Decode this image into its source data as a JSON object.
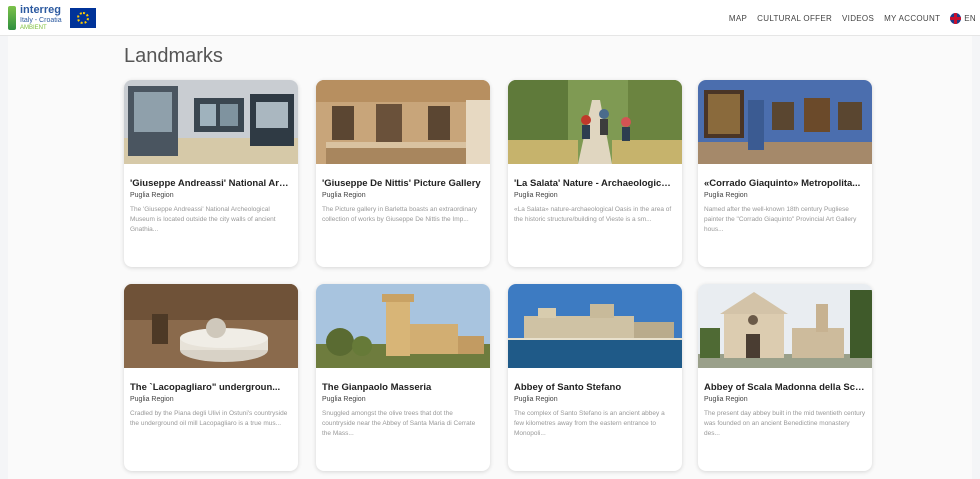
{
  "header": {
    "logo": {
      "line1": "interreg",
      "line2": "Italy - Croatia",
      "line3": "AMBIENT"
    },
    "nav": [
      {
        "label": "MAP"
      },
      {
        "label": "CULTURAL OFFER"
      },
      {
        "label": "VIDEOS"
      },
      {
        "label": "MY ACCOUNT"
      }
    ],
    "language": "EN"
  },
  "page": {
    "title": "Landmarks"
  },
  "cards": [
    {
      "title": "'Giuseppe Andreassi' National Arc...",
      "region": "Puglia Region",
      "description": "The 'Giuseppe Andreassi' National Archeological Museum is located outside the city walls of ancient Gnathia..."
    },
    {
      "title": "'Giuseppe De Nittis' Picture Gallery",
      "region": "Puglia Region",
      "description": "The Picture gallery in Barletta boasts an extraordinary collection of works by Giuseppe De Nittis the Imp..."
    },
    {
      "title": "'La Salata' Nature - Archaeological...",
      "region": "Puglia Region",
      "description": "«La Salata» nature-archaeological Oasis in the area of the historic structure/building of Vieste is a sm..."
    },
    {
      "title": "«Corrado Giaquinto» Metropolita...",
      "region": "Puglia Region",
      "description": "Named after the well-known 18th century Pugliese painter the \"Corrado Giaquinto\" Provincial Art Gallery hous..."
    },
    {
      "title": "The `Lacopagliaro\" undergroun...",
      "region": "Puglia Region",
      "description": "Cradled by the Piana degli Ulivi in Ostuni's countryside the underground oil mill Lacopagliaro is a true mus..."
    },
    {
      "title": "The Gianpaolo Masseria",
      "region": "Puglia Region",
      "description": "Snuggled amongst the olive trees that dot the countryside near the Abbey of Santa Maria di Cerrate the Mass..."
    },
    {
      "title": "Abbey of Santo Stefano",
      "region": "Puglia Region",
      "description": "The complex of Santo Stefano is an ancient abbey a few kilometres away from the eastern entrance to Monopoli..."
    },
    {
      "title": "Abbey of Scala Madonna della Scala",
      "region": "Puglia Region",
      "description": "The present day abbey built in the mid twentieth century was founded on an ancient Benedictine monastery des..."
    }
  ]
}
